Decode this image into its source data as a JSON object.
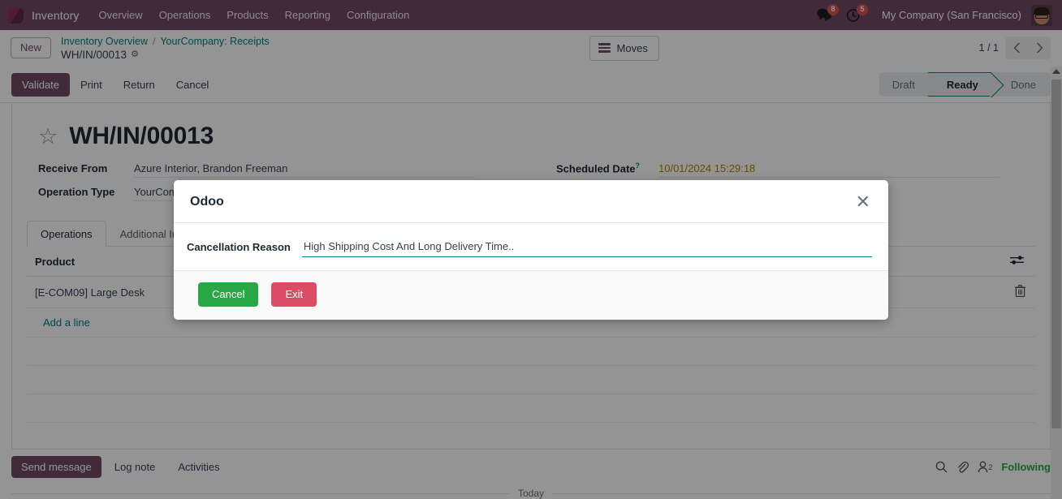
{
  "navbar": {
    "logo_icon": "odoo-cube-icon",
    "app_name": "Inventory",
    "menus": [
      "Overview",
      "Operations",
      "Products",
      "Reporting",
      "Configuration"
    ],
    "messages_icon": "chat-bubble-icon",
    "messages_badge": "8",
    "activities_icon": "clock-icon",
    "activities_badge": "5",
    "company": "My Company (San Francisco)",
    "avatar_icon": "user-avatar",
    "accent_color": "#714B67",
    "badge_color": "#d9534f"
  },
  "control_panel": {
    "new_label": "New",
    "breadcrumb": {
      "parent": "Inventory Overview",
      "separator": "/",
      "second": "YourCompany: Receipts",
      "current": "WH/IN/00013",
      "gear_icon": "gear-icon"
    },
    "moves_button": {
      "label": "Moves",
      "icon": "list-bars-icon"
    },
    "pager": {
      "count": "1 / 1",
      "prev_icon": "chevron-left-icon",
      "next_icon": "chevron-right-icon"
    }
  },
  "actions": {
    "buttons": [
      {
        "label": "Validate",
        "style": "primary"
      },
      {
        "label": "Print",
        "style": "secondary"
      },
      {
        "label": "Return",
        "style": "secondary"
      },
      {
        "label": "Cancel",
        "style": "secondary"
      }
    ],
    "statusbar": {
      "stages": [
        "Draft",
        "Ready",
        "Done"
      ],
      "active": "Ready",
      "active_color": "#017e84"
    }
  },
  "record": {
    "star_icon": "star-outline-icon",
    "title": "WH/IN/00013",
    "fields": [
      {
        "label": "Receive From",
        "value": "Azure Interior, Brandon Freeman",
        "column": "left"
      },
      {
        "label": "Operation Type",
        "value": "YourCompany: Receipts",
        "column": "left"
      },
      {
        "label": "Scheduled Date",
        "value": "10/01/2024 15:29:18",
        "column": "right",
        "help": "?",
        "value_color": "#b58100"
      }
    ]
  },
  "notebook": {
    "tabs": [
      {
        "label": "Operations",
        "active": true
      },
      {
        "label": "Additional Info",
        "active": false
      }
    ],
    "table": {
      "headers": [
        "Product"
      ],
      "optional_columns_icon": "sliders-icon",
      "rows": [
        {
          "product": "[E-COM09] Large Desk",
          "delete_icon": "trash-icon"
        }
      ],
      "add_line_label": "Add a line",
      "empty_rows": 3
    }
  },
  "chatter": {
    "buttons": [
      {
        "label": "Send message",
        "style": "primary"
      },
      {
        "label": "Log note",
        "style": "secondary"
      },
      {
        "label": "Activities",
        "style": "secondary"
      }
    ],
    "search_icon": "search-icon",
    "attachment_icon": "paperclip-icon",
    "followers_icon": "user-icon",
    "followers_count": "2",
    "following_label": "Following",
    "following_color": "#28a745",
    "date_separator": "Today"
  },
  "modal": {
    "title": "Odoo",
    "close_icon": "close-icon",
    "field_label": "Cancellation Reason",
    "field_value": "High Shipping Cost And Long Delivery Time..",
    "field_placeholder": "",
    "buttons": [
      {
        "label": "Cancel",
        "style": "green",
        "color": "#28a745"
      },
      {
        "label": "Exit",
        "style": "red",
        "color": "#dc4c64"
      }
    ]
  }
}
